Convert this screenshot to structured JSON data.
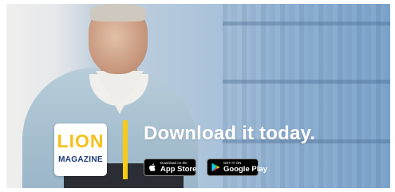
{
  "logo": {
    "top": "LION",
    "bottom": "MAGAZINE"
  },
  "headline": "Download it today.",
  "badges": {
    "apple": {
      "small": "Download on the",
      "big": "App Store",
      "icon": "apple-icon"
    },
    "google": {
      "small": "GET IT ON",
      "big": "Google Play",
      "icon": "google-play-icon"
    }
  },
  "colors": {
    "accent": "#f5cb16",
    "logo_blue": "#1a3a78",
    "background": "#8fb1d3"
  }
}
